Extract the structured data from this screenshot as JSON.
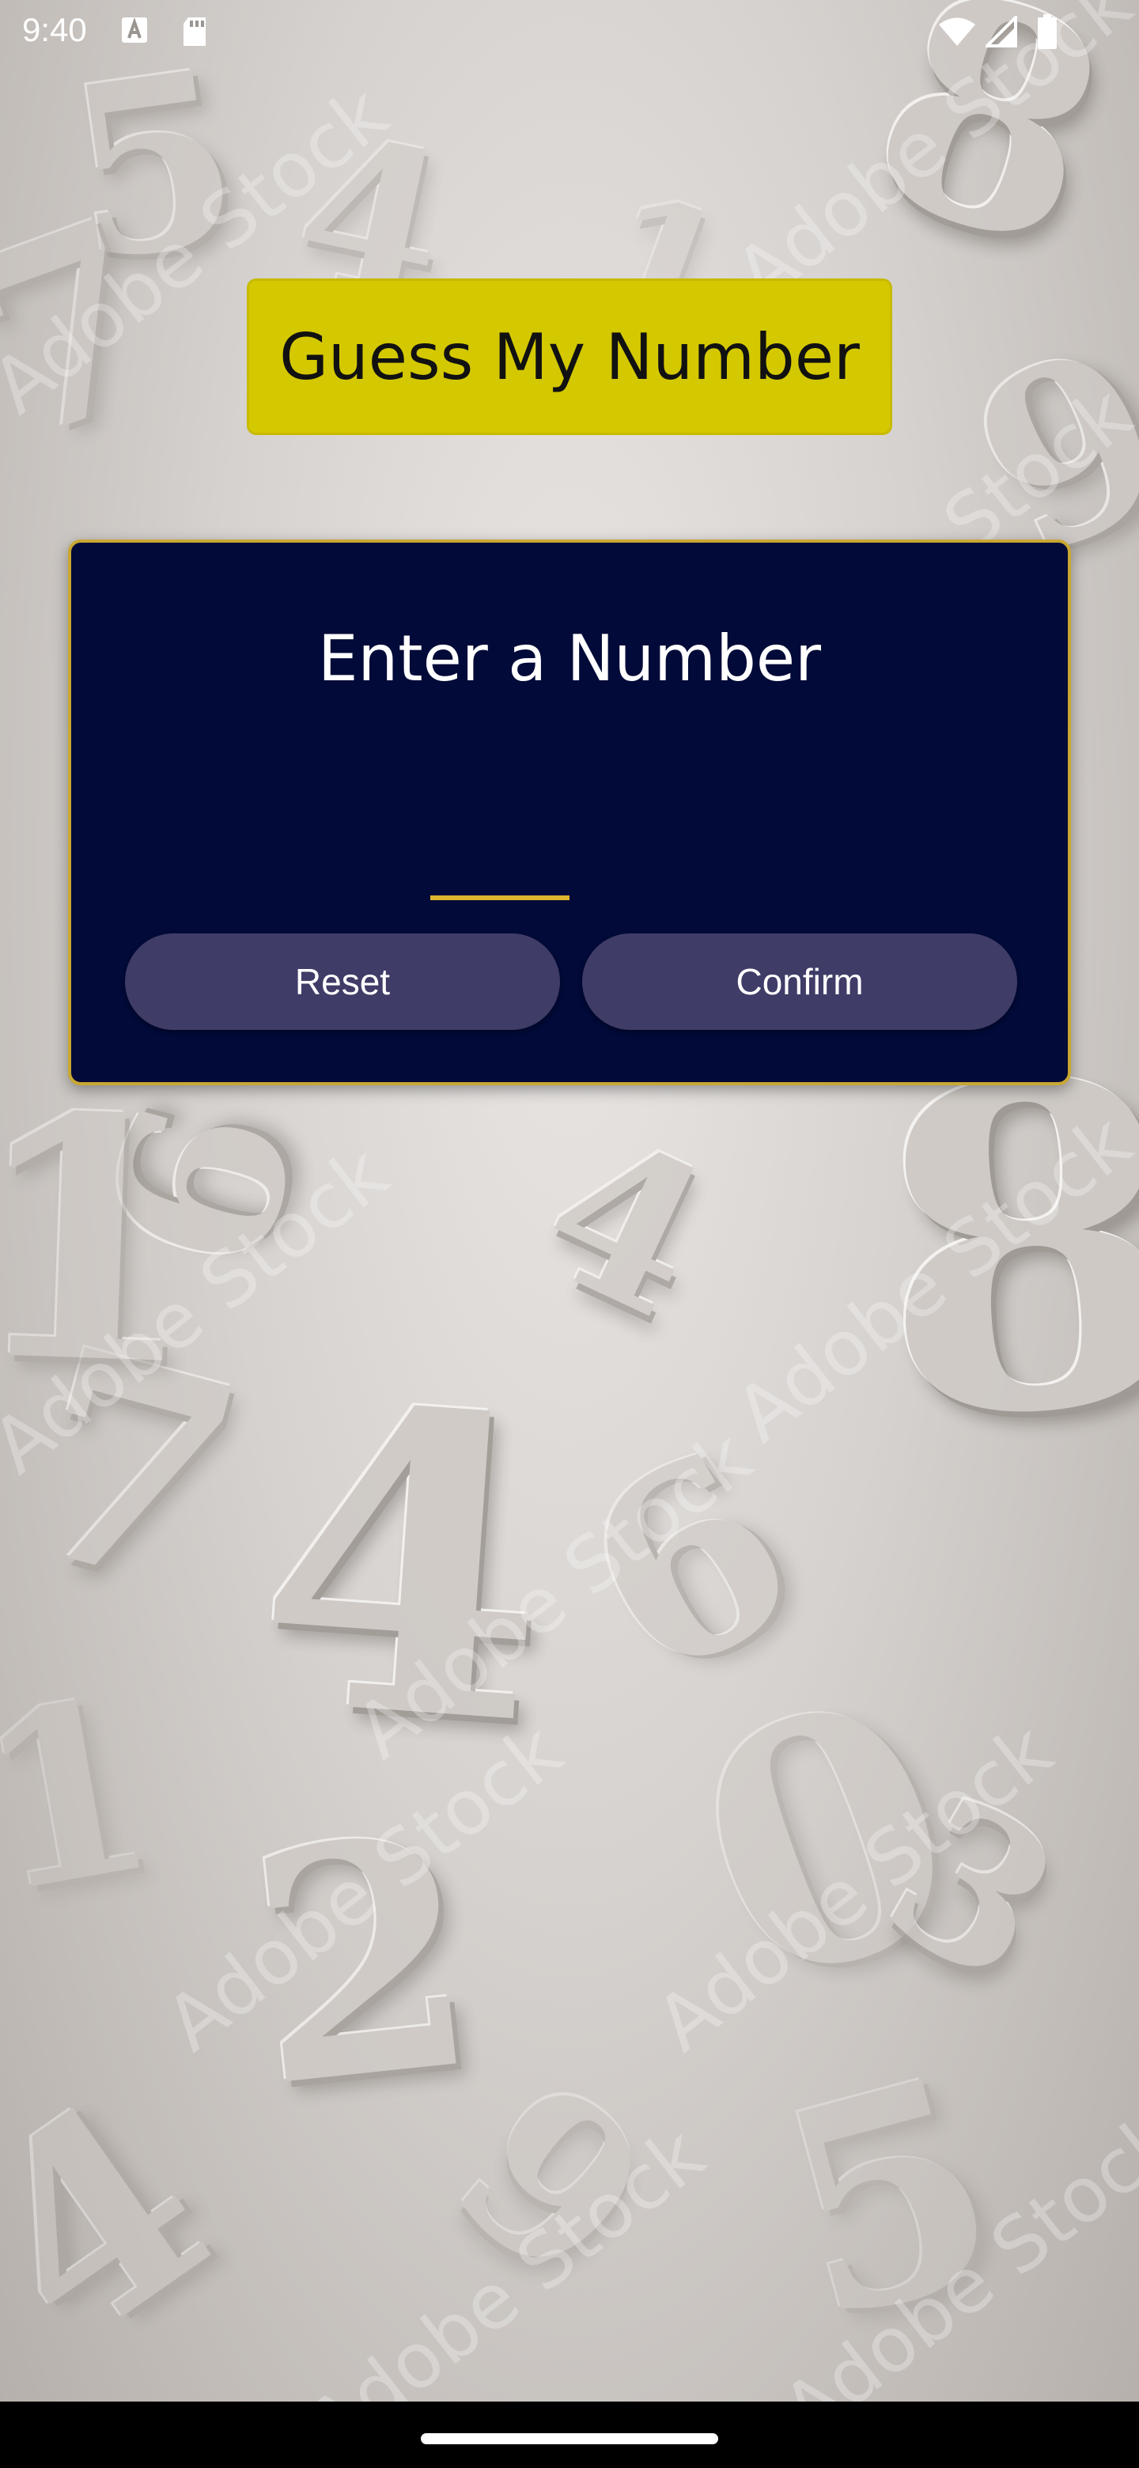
{
  "status_bar": {
    "time": "9:40",
    "icons": [
      "a-notification-icon",
      "sd-card-icon",
      "wifi-icon",
      "cell-signal-icon",
      "battery-icon"
    ]
  },
  "game": {
    "title": "Guess My Number",
    "card": {
      "heading": "Enter a Number",
      "input_value": "",
      "reset_label": "Reset",
      "confirm_label": "Confirm"
    }
  },
  "colors": {
    "title_background": "#d4c800",
    "card_background": "#010a38",
    "card_border": "#c9a832",
    "input_underline": "#ddb52f",
    "button_background": "#3f3c67",
    "button_text": "#ffffff",
    "nav_bar": "#000000"
  },
  "background": {
    "description_icon": "floating-3d-digits-image",
    "watermark": "Adobe Stock",
    "digits": [
      "5",
      "8",
      "7",
      "4",
      "1",
      "9",
      "6",
      "4",
      "8",
      "7",
      "1",
      "4",
      "6",
      "2",
      "0",
      "3",
      "4",
      "1",
      "9",
      "5"
    ]
  }
}
